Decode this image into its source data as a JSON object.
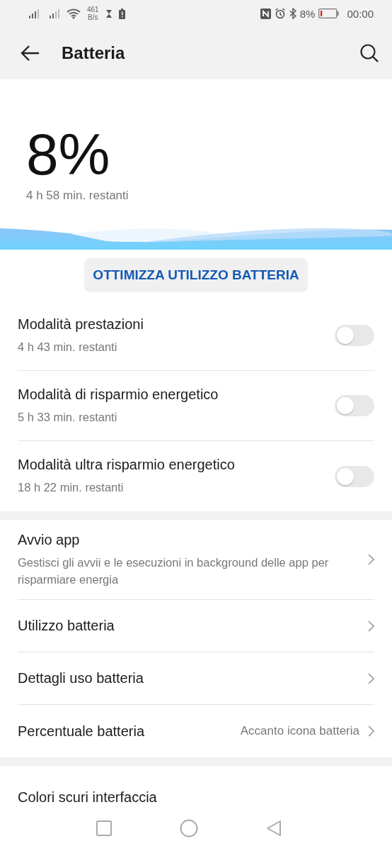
{
  "status_bar": {
    "net_speed_value": "461",
    "net_speed_unit": "B/s",
    "battery_percent": "8%",
    "time": "00:00"
  },
  "header": {
    "title": "Batteria"
  },
  "battery": {
    "percent": "8%",
    "remaining": "4 h 58 min. restanti"
  },
  "optimize_button": {
    "label": "OTTIMIZZA UTILIZZO BATTERIA"
  },
  "modes": [
    {
      "title": "Modalità prestazioni",
      "subtitle": "4 h 43 min. restanti",
      "on": false
    },
    {
      "title": "Modalità di risparmio energetico",
      "subtitle": "5 h 33 min. restanti",
      "on": false
    },
    {
      "title": "Modalità ultra risparmio energetico",
      "subtitle": "18 h 22 min. restanti",
      "on": false
    }
  ],
  "settings": [
    {
      "title": "Avvio app",
      "subtitle": "Gestisci gli avvii e le esecuzioni in background delle app per risparmiare energia"
    },
    {
      "title": "Utilizzo batteria"
    },
    {
      "title": "Dettagli uso batteria"
    },
    {
      "title": "Percentuale batteria",
      "value": "Accanto icona batteria"
    }
  ],
  "more": [
    {
      "title": "Colori scuri interfaccia"
    }
  ]
}
